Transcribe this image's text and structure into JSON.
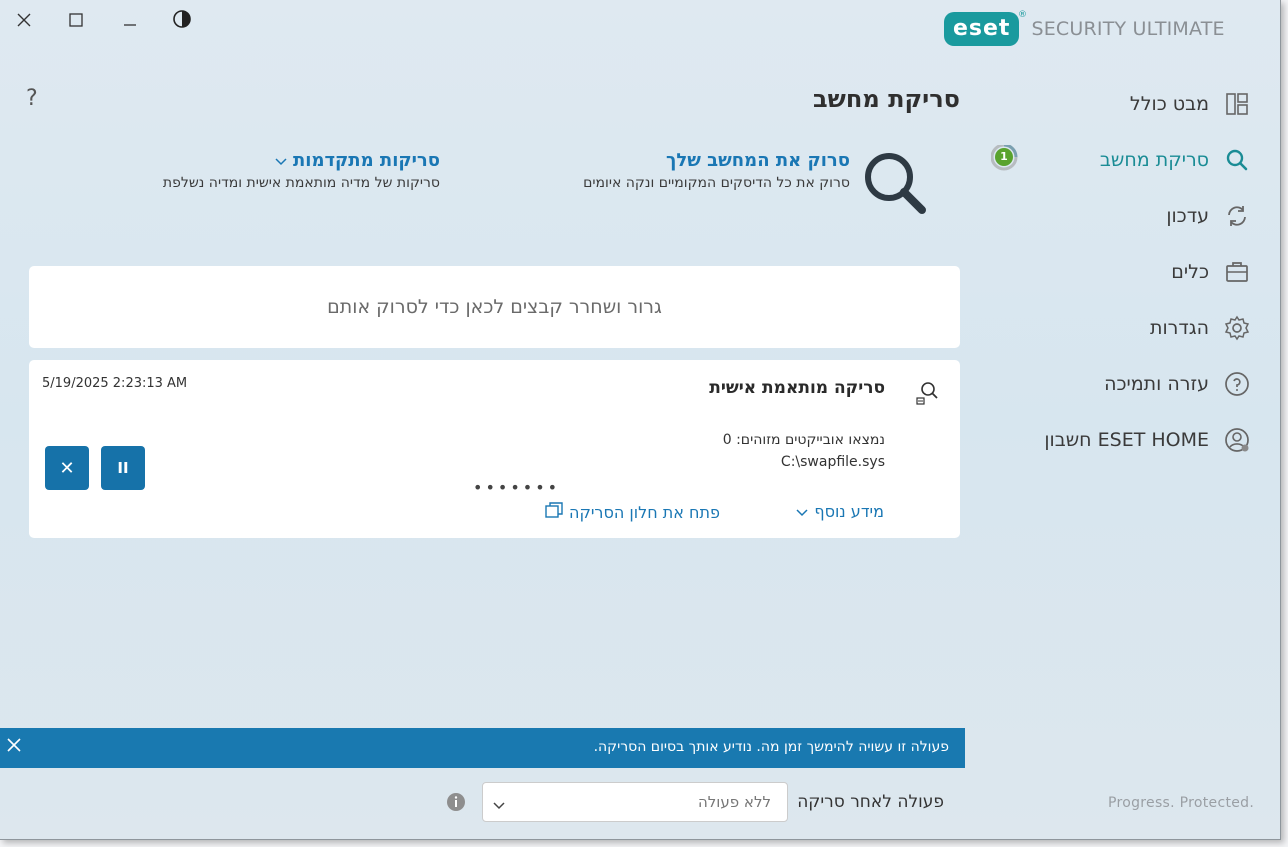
{
  "window": {
    "close_icon": "close-icon",
    "maximize_icon": "maximize-icon",
    "minimize_icon": "minimize-icon",
    "theme_icon": "contrast-icon"
  },
  "brand": {
    "logo_text": "eset",
    "product": "SECURITY ULTIMATE",
    "tagline": "Progress. Protected.",
    "accent": "#1a9a9e"
  },
  "sidebar": {
    "items": [
      {
        "label": "מבט כולל",
        "icon": "dashboard-icon"
      },
      {
        "label": "סריקת מחשב",
        "icon": "search-icon",
        "active": true,
        "badge": "1"
      },
      {
        "label": "עדכון",
        "icon": "refresh-icon"
      },
      {
        "label": "כלים",
        "icon": "briefcase-icon"
      },
      {
        "label": "הגדרות",
        "icon": "gear-icon"
      },
      {
        "label": "עזרה ותמיכה",
        "icon": "help-icon"
      },
      {
        "label": "חשבון ESET HOME",
        "icon": "account-icon"
      }
    ]
  },
  "main": {
    "title": "סריקת מחשב",
    "help": "?",
    "scan_computer": {
      "title": "סרוק את המחשב שלך",
      "subtitle": "סרוק את כל הדיסקים המקומיים ונקה איומים"
    },
    "advanced": {
      "title": "סריקות מתקדמות",
      "subtitle": "סריקות של מדיה מותאמת אישית ומדיה נשלפת"
    },
    "dropzone": "גרור ושחרר קבצים לכאן כדי לסרוק אותם",
    "card": {
      "title": "סריקה מותאמת אישית",
      "timestamp": "5/19/2025 2:23:13 AM",
      "found": "נמצאו אובייקטים מזוהים: 0",
      "path": "C:\\swapfile.sys",
      "progress_dots": "•••••••",
      "more_info": "מידע נוסף",
      "open_window": "פתח את חלון הסריקה",
      "pause_symbol": "II",
      "stop_symbol": "✕"
    },
    "notification": {
      "text": "פעולה זו עשויה להימשך זמן מה. נודיע אותך בסיום הסריקה."
    },
    "after_scan": {
      "label": "פעולה לאחר סריקה",
      "value": "ללא פעולה"
    }
  },
  "colors": {
    "link": "#1a77b4",
    "button": "#1672a9",
    "notify_bar": "#1979b0",
    "badge": "#5aa32e"
  }
}
